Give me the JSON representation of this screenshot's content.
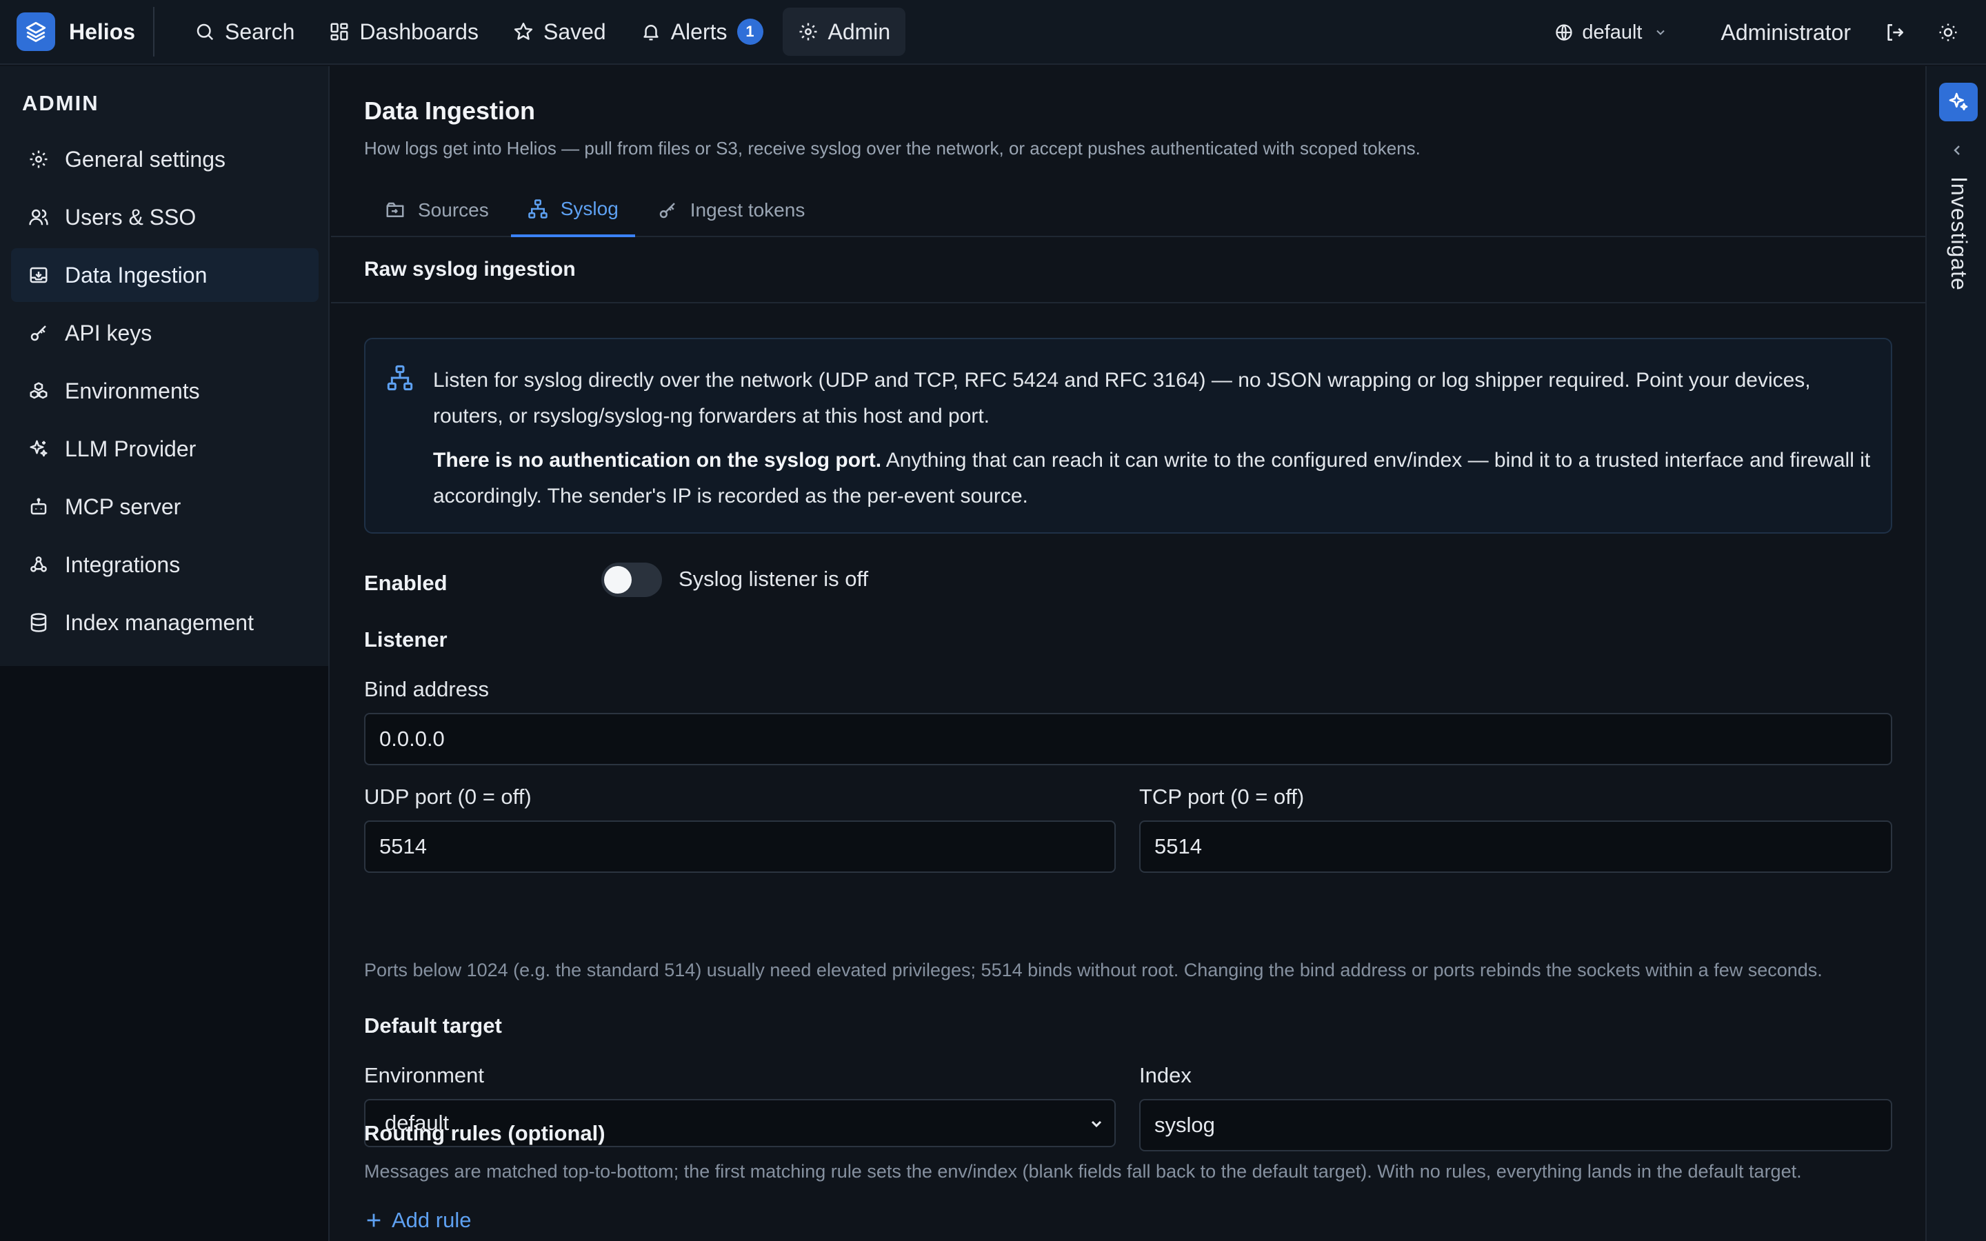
{
  "brand": {
    "name": "Helios"
  },
  "nav": {
    "search": "Search",
    "dashboards": "Dashboards",
    "saved": "Saved",
    "alerts": "Alerts",
    "alerts_count": "1",
    "admin": "Admin"
  },
  "top_right": {
    "environment": "default",
    "user": "Administrator"
  },
  "sidebar": {
    "heading": "ADMIN",
    "items": [
      {
        "label": "General settings",
        "icon": "gear-icon"
      },
      {
        "label": "Users & SSO",
        "icon": "users-icon"
      },
      {
        "label": "Data Ingestion",
        "icon": "inbox-download-icon",
        "active": true
      },
      {
        "label": "API keys",
        "icon": "key-icon"
      },
      {
        "label": "Environments",
        "icon": "boxes-icon"
      },
      {
        "label": "LLM Provider",
        "icon": "sparkles-icon"
      },
      {
        "label": "MCP server",
        "icon": "bot-icon"
      },
      {
        "label": "Integrations",
        "icon": "webhook-icon"
      },
      {
        "label": "Index management",
        "icon": "database-icon"
      }
    ]
  },
  "page": {
    "title": "Data Ingestion",
    "description": "How logs get into Helios — pull from files or S3, receive syslog over the network, or accept pushes authenticated with scoped tokens."
  },
  "tabs": [
    {
      "label": "Sources",
      "icon": "sources-icon"
    },
    {
      "label": "Syslog",
      "icon": "network-icon",
      "active": true
    },
    {
      "label": "Ingest tokens",
      "icon": "key-icon"
    }
  ],
  "section": {
    "title": "Raw syslog ingestion"
  },
  "info": {
    "p1": "Listen for syslog directly over the network (UDP and TCP, RFC 5424 and RFC 3164) — no JSON wrapping or log shipper required. Point your devices, routers, or rsyslog/syslog-ng forwarders at this host and port.",
    "p2_bold": "There is no authentication on the syslog port.",
    "p2_rest": " Anything that can reach it can write to the configured env/index — bind it to a trusted interface and firewall it accordingly. The sender's IP is recorded as the per-event source."
  },
  "enabled": {
    "label": "Enabled",
    "state": false,
    "status_text": "Syslog listener is off"
  },
  "listener": {
    "heading": "Listener",
    "bind_label": "Bind address",
    "bind_value": "0.0.0.0",
    "udp_label": "UDP port (0 = off)",
    "udp_value": "5514",
    "tcp_label": "TCP port (0 = off)",
    "tcp_value": "5514",
    "hint": "Ports below 1024 (e.g. the standard 514) usually need elevated privileges; 5514 binds without root. Changing the bind address or ports rebinds the sockets within a few seconds."
  },
  "default_target": {
    "heading": "Default target",
    "env_label": "Environment",
    "env_value": "default",
    "index_label": "Index",
    "index_value": "syslog"
  },
  "routing": {
    "heading": "Routing rules (optional)",
    "hint": "Messages are matched top-to-bottom; the first matching rule sets the env/index (blank fields fall back to the default target). With no rules, everything lands in the default target.",
    "add_label": "Add rule"
  },
  "rail": {
    "label": "Investigate"
  },
  "colors": {
    "accent": "#3b82f6",
    "brand": "#2f6fd8",
    "background": "#0f141b"
  }
}
